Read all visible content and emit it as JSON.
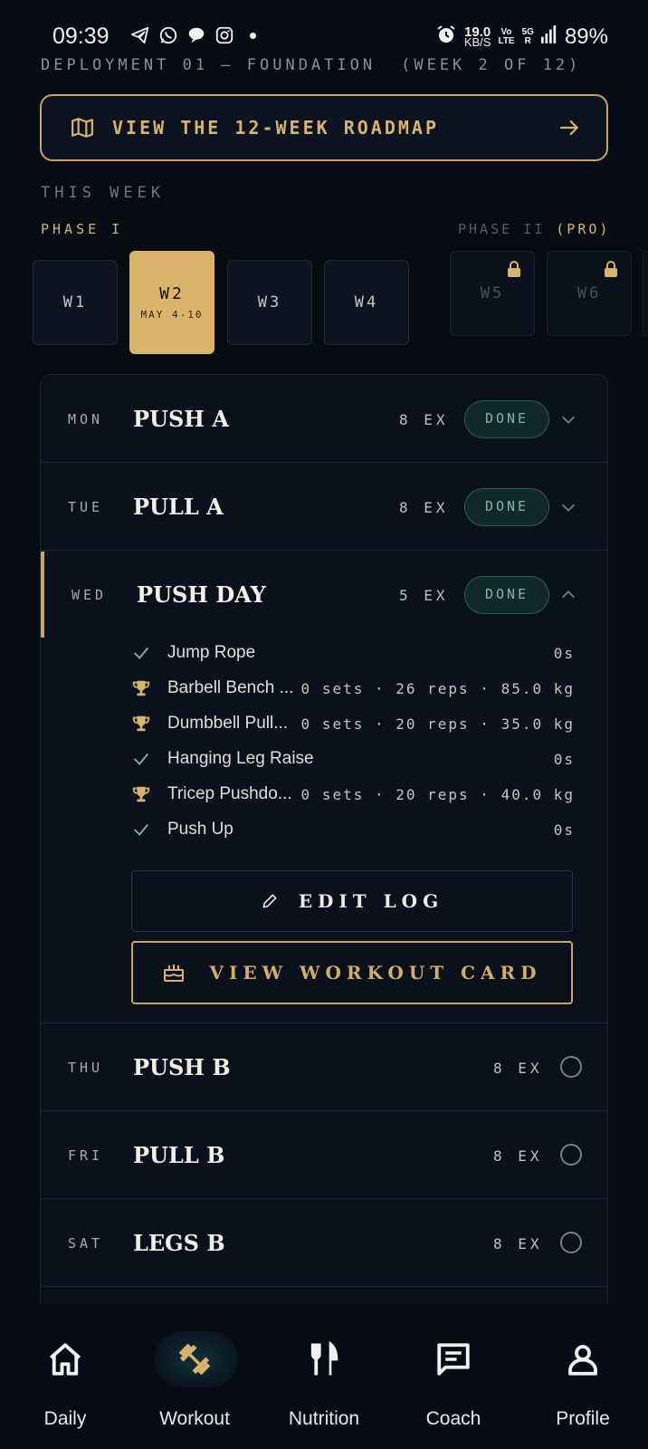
{
  "status_bar": {
    "time": "09:39",
    "speed_value": "19.0",
    "speed_unit": "KB/S",
    "volte_top": "Vo",
    "volte_bottom": "LTE",
    "net_top": "5G",
    "net_bottom": "R",
    "battery": "89%"
  },
  "header": {
    "deployment": "DEPLOYMENT 01 — FOUNDATION",
    "week_of": "(WEEK 2 OF 12)",
    "roadmap_label": "VIEW THE 12-WEEK ROADMAP",
    "this_week": "THIS WEEK",
    "phase1": "PHASE I",
    "phase2": "PHASE II",
    "phase2_pro": "(PRO)"
  },
  "weeks": [
    {
      "label": "W1",
      "date": "",
      "state": "normal"
    },
    {
      "label": "W2",
      "date": "MAY 4-10",
      "state": "active"
    },
    {
      "label": "W3",
      "date": "",
      "state": "normal"
    },
    {
      "label": "W4",
      "date": "",
      "state": "normal"
    },
    {
      "label": "W5",
      "date": "",
      "state": "locked"
    },
    {
      "label": "W6",
      "date": "",
      "state": "locked"
    }
  ],
  "days": [
    {
      "day": "MON",
      "title": "PUSH A",
      "ex": "8 EX",
      "status": "DONE"
    },
    {
      "day": "TUE",
      "title": "PULL A",
      "ex": "8 EX",
      "status": "DONE"
    },
    {
      "day": "WED",
      "title": "PUSH DAY",
      "ex": "5 EX",
      "status": "DONE"
    },
    {
      "day": "THU",
      "title": "PUSH B",
      "ex": "8 EX",
      "status": ""
    },
    {
      "day": "FRI",
      "title": "PULL B",
      "ex": "8 EX",
      "status": ""
    },
    {
      "day": "SAT",
      "title": "LEGS B",
      "ex": "8 EX",
      "status": ""
    }
  ],
  "exercises": [
    {
      "icon": "check-icon",
      "name": "Jump Rope",
      "detail": "0s"
    },
    {
      "icon": "trophy-icon",
      "name": "Barbell Bench ...",
      "detail": "0 sets · 26 reps · 85.0 kg"
    },
    {
      "icon": "trophy-icon",
      "name": "Dumbbell Pull...",
      "detail": "0 sets · 20 reps · 35.0 kg"
    },
    {
      "icon": "check-icon",
      "name": "Hanging Leg Raise",
      "detail": "0s"
    },
    {
      "icon": "trophy-icon",
      "name": "Tricep Pushdo...",
      "detail": "0 sets · 20 reps · 40.0 kg"
    },
    {
      "icon": "check-icon",
      "name": "Push Up",
      "detail": "0s"
    }
  ],
  "actions": {
    "edit_log": "EDIT LOG",
    "view_card": "VIEW WORKOUT CARD"
  },
  "nav": [
    {
      "label": "Daily",
      "icon": "home-icon"
    },
    {
      "label": "Workout",
      "icon": "dumbbell-icon"
    },
    {
      "label": "Nutrition",
      "icon": "fork-knife-icon"
    },
    {
      "label": "Coach",
      "icon": "chat-icon"
    },
    {
      "label": "Profile",
      "icon": "person-icon"
    }
  ],
  "colors": {
    "gold": "#d8b36a",
    "background": "#070c14",
    "done_green": "#7fb6a7"
  }
}
